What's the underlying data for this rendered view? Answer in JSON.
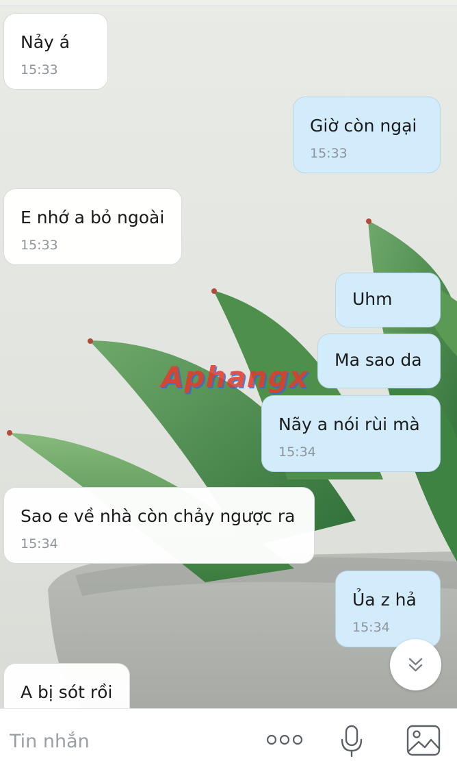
{
  "watermark": "Aphangx",
  "messages": [
    {
      "text": "Nảy á",
      "time": "15:33",
      "side": "in"
    },
    {
      "text": "Giờ còn ngại",
      "time": "15:33",
      "side": "out"
    },
    {
      "text": "E nhớ a bỏ ngoài",
      "time": "15:33",
      "side": "in"
    },
    {
      "text": "Uhm",
      "time": "",
      "side": "out"
    },
    {
      "text": "Ma sao da",
      "time": "",
      "side": "out"
    },
    {
      "text": "Nãy a nói rùi mà",
      "time": "15:34",
      "side": "out"
    },
    {
      "text": "Sao e về nhà còn chảy ngược ra",
      "time": "15:34",
      "side": "in"
    },
    {
      "text": "Ủa z hả",
      "time": "15:34",
      "side": "out"
    },
    {
      "text": "A bị sót rồi",
      "time": "",
      "side": "in"
    }
  ],
  "composer": {
    "placeholder": "Tin nhắn",
    "icons": [
      "more-options-icon",
      "microphone-icon",
      "image-icon"
    ]
  },
  "scroll_button": {
    "icon": "double-chevron-down-icon"
  },
  "colors": {
    "incoming_bubble": "#ffffff",
    "outgoing_bubble": "#d3ecfb",
    "time_text": "#8d9398"
  }
}
